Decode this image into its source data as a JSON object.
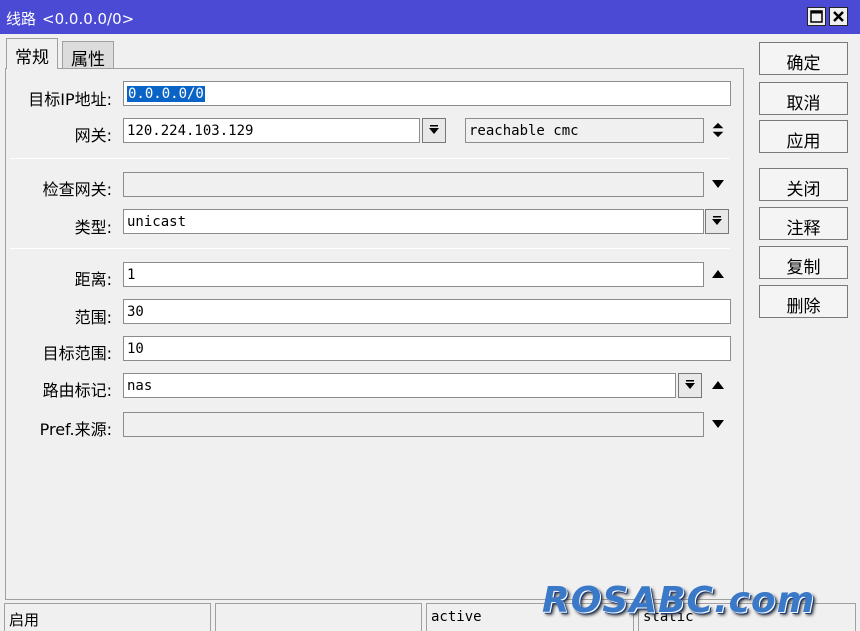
{
  "window": {
    "title": "线路",
    "subtitle": "<0.0.0.0/0>",
    "icons": [
      "maximize-icon",
      "close-icon"
    ]
  },
  "tabs": [
    {
      "label": "常规",
      "active": true
    },
    {
      "label": "属性",
      "active": false
    }
  ],
  "form": {
    "dst_address": {
      "label": "目标IP地址:",
      "value": "0.0.0.0/0"
    },
    "gateway": {
      "label": "网关:",
      "value": "120.224.103.129",
      "state": "reachable cmc"
    },
    "check_gateway": {
      "label": "检查网关:",
      "value": ""
    },
    "type": {
      "label": "类型:",
      "value": "unicast"
    },
    "distance": {
      "label": "距离:",
      "value": "1"
    },
    "scope": {
      "label": "范围:",
      "value": "30"
    },
    "target_scope": {
      "label": "目标范围:",
      "value": "10"
    },
    "routing_mark": {
      "label": "路由标记:",
      "value": "nas"
    },
    "pref_src": {
      "label": "Pref.来源:",
      "value": ""
    }
  },
  "buttons": {
    "ok": "确定",
    "cancel": "取消",
    "apply": "应用",
    "close": "关闭",
    "comment": "注释",
    "copy": "复制",
    "remove": "删除"
  },
  "status": {
    "enabled": "启用",
    "blank": "",
    "active": "active",
    "static": "static"
  },
  "watermark": "ROSABC.com",
  "colors": {
    "titlebar": "#4a4ad4",
    "selection": "#0a64c8",
    "watermark": "#3a78c8"
  }
}
